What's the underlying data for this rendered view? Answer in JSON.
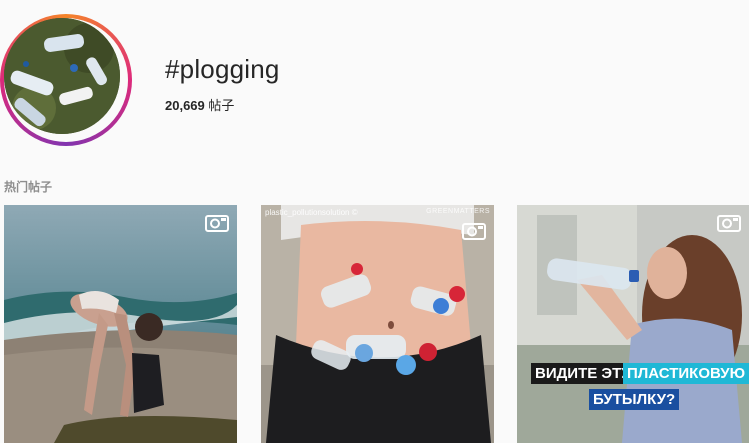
{
  "header": {
    "hashtag": "#plogging",
    "post_count_number": "20,669",
    "post_count_unit": "帖子"
  },
  "top_posts": {
    "label": "热门帖子",
    "items": [
      {
        "type": "video",
        "icon": "video-icon"
      },
      {
        "type": "video",
        "icon": "video-icon",
        "caption": "plastic_pollutionsolution ©",
        "brand": "GREENMATTERS"
      },
      {
        "type": "video",
        "icon": "video-icon",
        "overlay_line1_a": "ВИДИТЕ ЭТУ",
        "overlay_line1_b": "ПЛАСТИКОВУЮ",
        "overlay_line2": "БУТЫЛКУ?"
      }
    ]
  },
  "colors": {
    "background": "#fafafa",
    "text": "#262626",
    "muted": "#8e8e8e",
    "highlight_cyan": "#1fb8d6",
    "highlight_blue": "#1a4fa0"
  }
}
